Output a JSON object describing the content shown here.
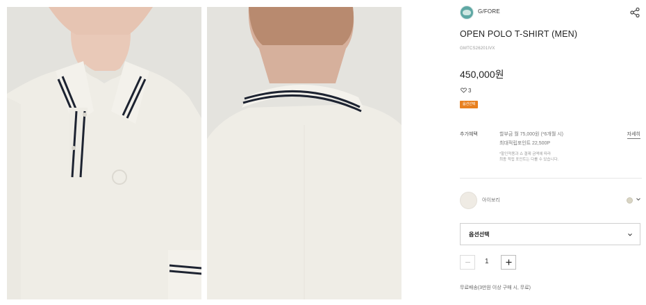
{
  "brand": {
    "name": "G/FORE",
    "logo": "brand-logo"
  },
  "product": {
    "title": "OPEN POLO T-SHIRT (MEN)",
    "code": "GMTCS26201IVX",
    "price": "450,000원",
    "likes": "3",
    "badge": "옵션선택"
  },
  "benefits": {
    "label": "추가혜택",
    "line1": "할부금 월 75,000원 (*6개월 시)",
    "line2": "최대적립포인트 22,500P",
    "note1": "*할인적용과 쇼 결제 금액에 따라",
    "note2": "최종 적립 포인트는 다를 수 있습니다.",
    "detail_link": "자세히"
  },
  "color": {
    "name": "아이보리",
    "swatch": "#efebe4"
  },
  "option_select": {
    "label": "옵션선택"
  },
  "quantity": {
    "value": "1"
  },
  "shipping": "무료배송(3만원 이상 구매 시, 무료)",
  "icons": [
    "share-icon",
    "heart-icon",
    "chevron-down-icon",
    "minus-icon",
    "plus-icon"
  ],
  "colors": {
    "badge": "#e8801f",
    "shirt": "#efede6",
    "trim": "#1d2331"
  }
}
